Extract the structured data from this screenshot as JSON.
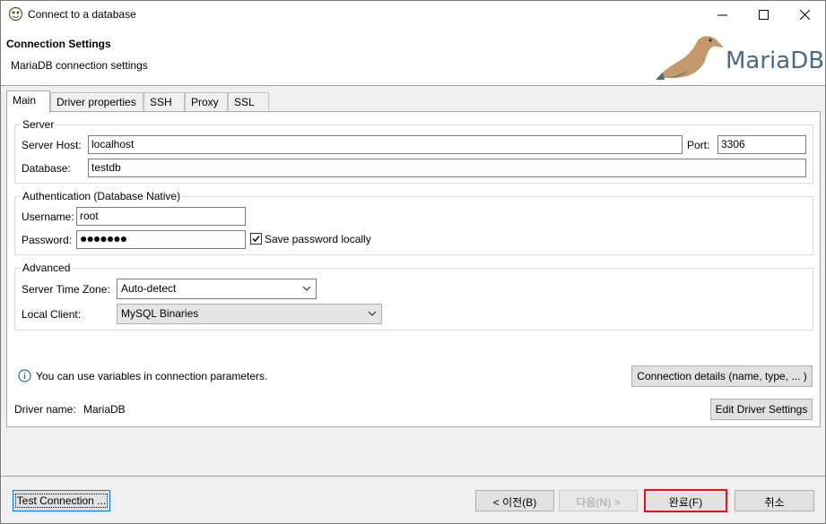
{
  "window": {
    "title": "Connect to a database"
  },
  "header": {
    "title": "Connection Settings",
    "subtitle": "MariaDB connection settings",
    "logo_text": "MariaDB"
  },
  "tabs": [
    {
      "label": "Main",
      "active": true
    },
    {
      "label": "Driver properties"
    },
    {
      "label": "SSH"
    },
    {
      "label": "Proxy"
    },
    {
      "label": "SSL"
    }
  ],
  "server": {
    "group_label": "Server",
    "host_label": "Server Host:",
    "host_value": "localhost",
    "port_label": "Port:",
    "port_value": "3306",
    "database_label": "Database:",
    "database_value": "testdb"
  },
  "auth": {
    "group_label": "Authentication (Database Native)",
    "username_label": "Username:",
    "username_value": "root",
    "password_label": "Password:",
    "password_value": "●●●●●●●",
    "save_password_label": "Save password locally",
    "save_password_checked": true
  },
  "advanced": {
    "group_label": "Advanced",
    "timezone_label": "Server Time Zone:",
    "timezone_value": "Auto-detect",
    "client_label": "Local Client:",
    "client_value": "MySQL Binaries"
  },
  "info": {
    "variables_text": "You can use variables in connection parameters.",
    "details_button": "Connection details (name, type, ... )",
    "driver_name_label": "Driver name:",
    "driver_name_value": "MariaDB",
    "edit_driver_button": "Edit Driver Settings"
  },
  "footer": {
    "test_button": "Test Connection ...",
    "back_button": "< 이전(B)",
    "next_button": "다음(N) >",
    "finish_button": "완료(F)",
    "cancel_button": "취소"
  },
  "colors": {
    "accent": "#e81123",
    "logo": "#4b6a82",
    "seal": "#c49a6c"
  }
}
